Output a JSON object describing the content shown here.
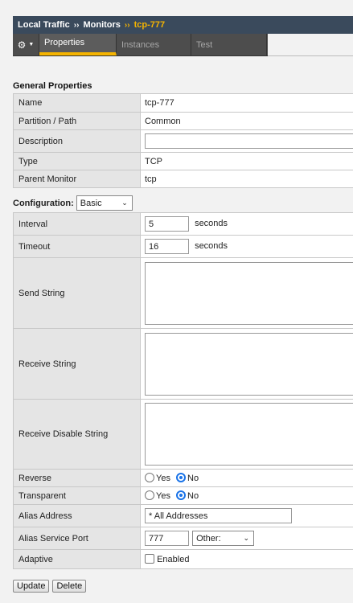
{
  "breadcrumb": {
    "root": "Local Traffic",
    "section": "Monitors",
    "current": "tcp-777",
    "separator": "››"
  },
  "tabs": {
    "gear_icon": "gear-icon",
    "items": [
      {
        "label": "Properties",
        "active": true
      },
      {
        "label": "Instances",
        "active": false
      },
      {
        "label": "Test",
        "active": false
      }
    ]
  },
  "general": {
    "title": "General Properties",
    "rows": {
      "name": {
        "label": "Name",
        "value": "tcp-777"
      },
      "partition": {
        "label": "Partition / Path",
        "value": "Common"
      },
      "description": {
        "label": "Description",
        "value": ""
      },
      "type": {
        "label": "Type",
        "value": "TCP"
      },
      "parent": {
        "label": "Parent Monitor",
        "value": "tcp"
      }
    }
  },
  "configuration": {
    "label": "Configuration:",
    "mode": "Basic",
    "interval": {
      "label": "Interval",
      "value": "5",
      "unit": "seconds"
    },
    "timeout": {
      "label": "Timeout",
      "value": "16",
      "unit": "seconds"
    },
    "send_string": {
      "label": "Send String",
      "value": ""
    },
    "receive_string": {
      "label": "Receive String",
      "value": ""
    },
    "receive_disable": {
      "label": "Receive Disable String",
      "value": ""
    },
    "reverse": {
      "label": "Reverse",
      "yes": "Yes",
      "no": "No",
      "selected": "No"
    },
    "transparent": {
      "label": "Transparent",
      "yes": "Yes",
      "no": "No",
      "selected": "No"
    },
    "alias_address": {
      "label": "Alias Address",
      "value": "* All Addresses"
    },
    "alias_port": {
      "label": "Alias Service Port",
      "value": "777",
      "select": "Other:"
    },
    "adaptive": {
      "label": "Adaptive",
      "option": "Enabled",
      "checked": false
    }
  },
  "buttons": {
    "update": "Update",
    "delete": "Delete"
  },
  "colors": {
    "accent": "#f5b400",
    "header_bg": "#3a4a5c",
    "tab_bg": "#4d4d4d",
    "radio": "#1a73e8"
  }
}
